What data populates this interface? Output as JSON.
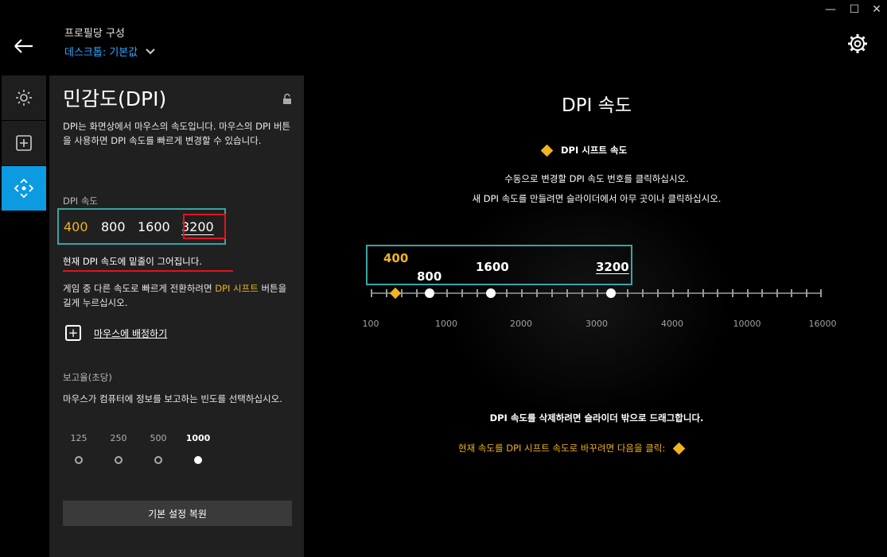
{
  "window": {
    "minimize": "—",
    "maximize": "☐",
    "close": "✕"
  },
  "header": {
    "title": "프로필당 구성",
    "profile": "데스크톱: 기본값"
  },
  "nav": {
    "items": [
      "lighting",
      "assignments",
      "sensitivity"
    ],
    "active": "sensitivity"
  },
  "panel": {
    "title": "민감도(DPI)",
    "description": "DPI는 화면상에서 마우스의 속도입니다. 마우스의 DPI 버튼을 사용하면 DPI 속도를 빠르게 변경할 수 있습니다.",
    "dpi_label": "DPI 속도",
    "dpi_values": [
      "400",
      "800",
      "1600",
      "3200"
    ],
    "current_note": "현재 DPI 속도에 밑줄이 그어집니다.",
    "shift_text_before": "게임 중 다른 속도로 빠르게 전환하려면 ",
    "shift_text_highlight": "DPI 시프트",
    "shift_text_after": " 버튼을 길게 누르십시오.",
    "assign_label": "마우스에 배정하기",
    "rate_label": "보고율(초당)",
    "rate_desc": "마우스가 컴퓨터에 정보를 보고하는 빈도를 선택하십시오.",
    "rates": [
      "125",
      "250",
      "500",
      "1000"
    ],
    "selected_rate": "1000",
    "reset_label": "기본 설정 복원"
  },
  "main": {
    "title": "DPI 속도",
    "shift_label": "DPI 시프트 속도",
    "instr1": "수동으로 변경할 DPI 속도 번호를 클릭하십시오.",
    "instr2": "새 DPI 속도를 만들려면 슬라이더에서 아무 곳이나 클릭하십시오.",
    "slider_values": [
      "400",
      "800",
      "1600",
      "3200"
    ],
    "current_dpi": "3200",
    "dpi_shift_value": "400",
    "axis_labels": [
      "100",
      "1000",
      "2000",
      "3000",
      "4000",
      "10000",
      "16000"
    ],
    "delete_note": "DPI 속도를 삭제하려면 슬라이더 밖으로 드래그합니다.",
    "change_note": "현재 속도를 DPI 시프트 속도로 바꾸려면 다음을 클릭:"
  },
  "colors": {
    "accent": "#0c9be0",
    "shift": "#f0b41e",
    "highlight": "#e0141e",
    "box": "#3aa4a4"
  }
}
